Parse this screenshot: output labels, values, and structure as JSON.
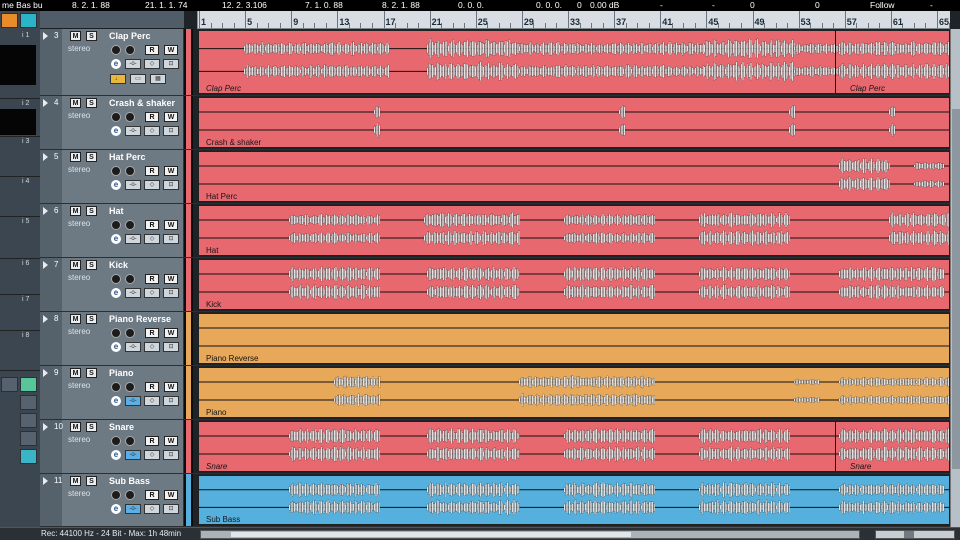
{
  "top_bar": {
    "values": [
      "me Bas bu",
      "8. 2. 1. 88",
      "21. 1. 1. 74",
      "12. 2. 3.106",
      "7. 1. 0. 88",
      "8. 2. 1. 88",
      "0. 0. 0.",
      "0. 0. 0.",
      "0",
      "0.00 dB",
      "-",
      "-",
      "0",
      "0",
      "Follow",
      "-"
    ]
  },
  "left_panel": {
    "rows": [
      "i 1",
      "i 2",
      "i 3",
      "i 4",
      "i 5",
      "i 6",
      "i 7",
      "i 8"
    ]
  },
  "ruler": {
    "bars": [
      "1",
      "5",
      "9",
      "13",
      "17",
      "21",
      "25",
      "29",
      "33",
      "37",
      "41",
      "45",
      "49",
      "53",
      "57",
      "61",
      "65"
    ]
  },
  "tracks": [
    {
      "num": "3",
      "name": "Clap Perc",
      "type": "stereo",
      "color": "#e8686f",
      "label": "Clap Perc",
      "label2": "Clap Perc",
      "italic": true
    },
    {
      "num": "4",
      "name": "Crash & shaker",
      "type": "stereo",
      "color": "#e8686f",
      "label": "Crash & shaker",
      "italic": false
    },
    {
      "num": "5",
      "name": "Hat Perc",
      "type": "stereo",
      "color": "#e8686f",
      "label": "Hat Perc",
      "italic": false
    },
    {
      "num": "6",
      "name": "Hat",
      "type": "stereo",
      "color": "#e8686f",
      "label": "Hat",
      "italic": false
    },
    {
      "num": "7",
      "name": "Kick",
      "type": "stereo",
      "color": "#e8686f",
      "label": "Kick",
      "italic": false
    },
    {
      "num": "8",
      "name": "Piano Reverse",
      "type": "stereo",
      "color": "#e8a85a",
      "label": "Piano Reverse",
      "italic": false
    },
    {
      "num": "9",
      "name": "Piano",
      "type": "stereo",
      "color": "#e8a85a",
      "label": "Piano",
      "italic": false
    },
    {
      "num": "10",
      "name": "Snare",
      "type": "stereo",
      "color": "#e8686f",
      "label": "Snare",
      "label2": "Snare",
      "italic": true
    },
    {
      "num": "11",
      "name": "Sub Bass",
      "type": "stereo",
      "color": "#56b0dd",
      "label": "Sub Bass",
      "italic": false
    }
  ],
  "buttons": {
    "mute": "M",
    "solo": "S",
    "read": "R",
    "write": "W",
    "edit": "e"
  },
  "status": {
    "text": "Rec: 44100 Hz - 24 Bit - Max: 1h 48min"
  }
}
